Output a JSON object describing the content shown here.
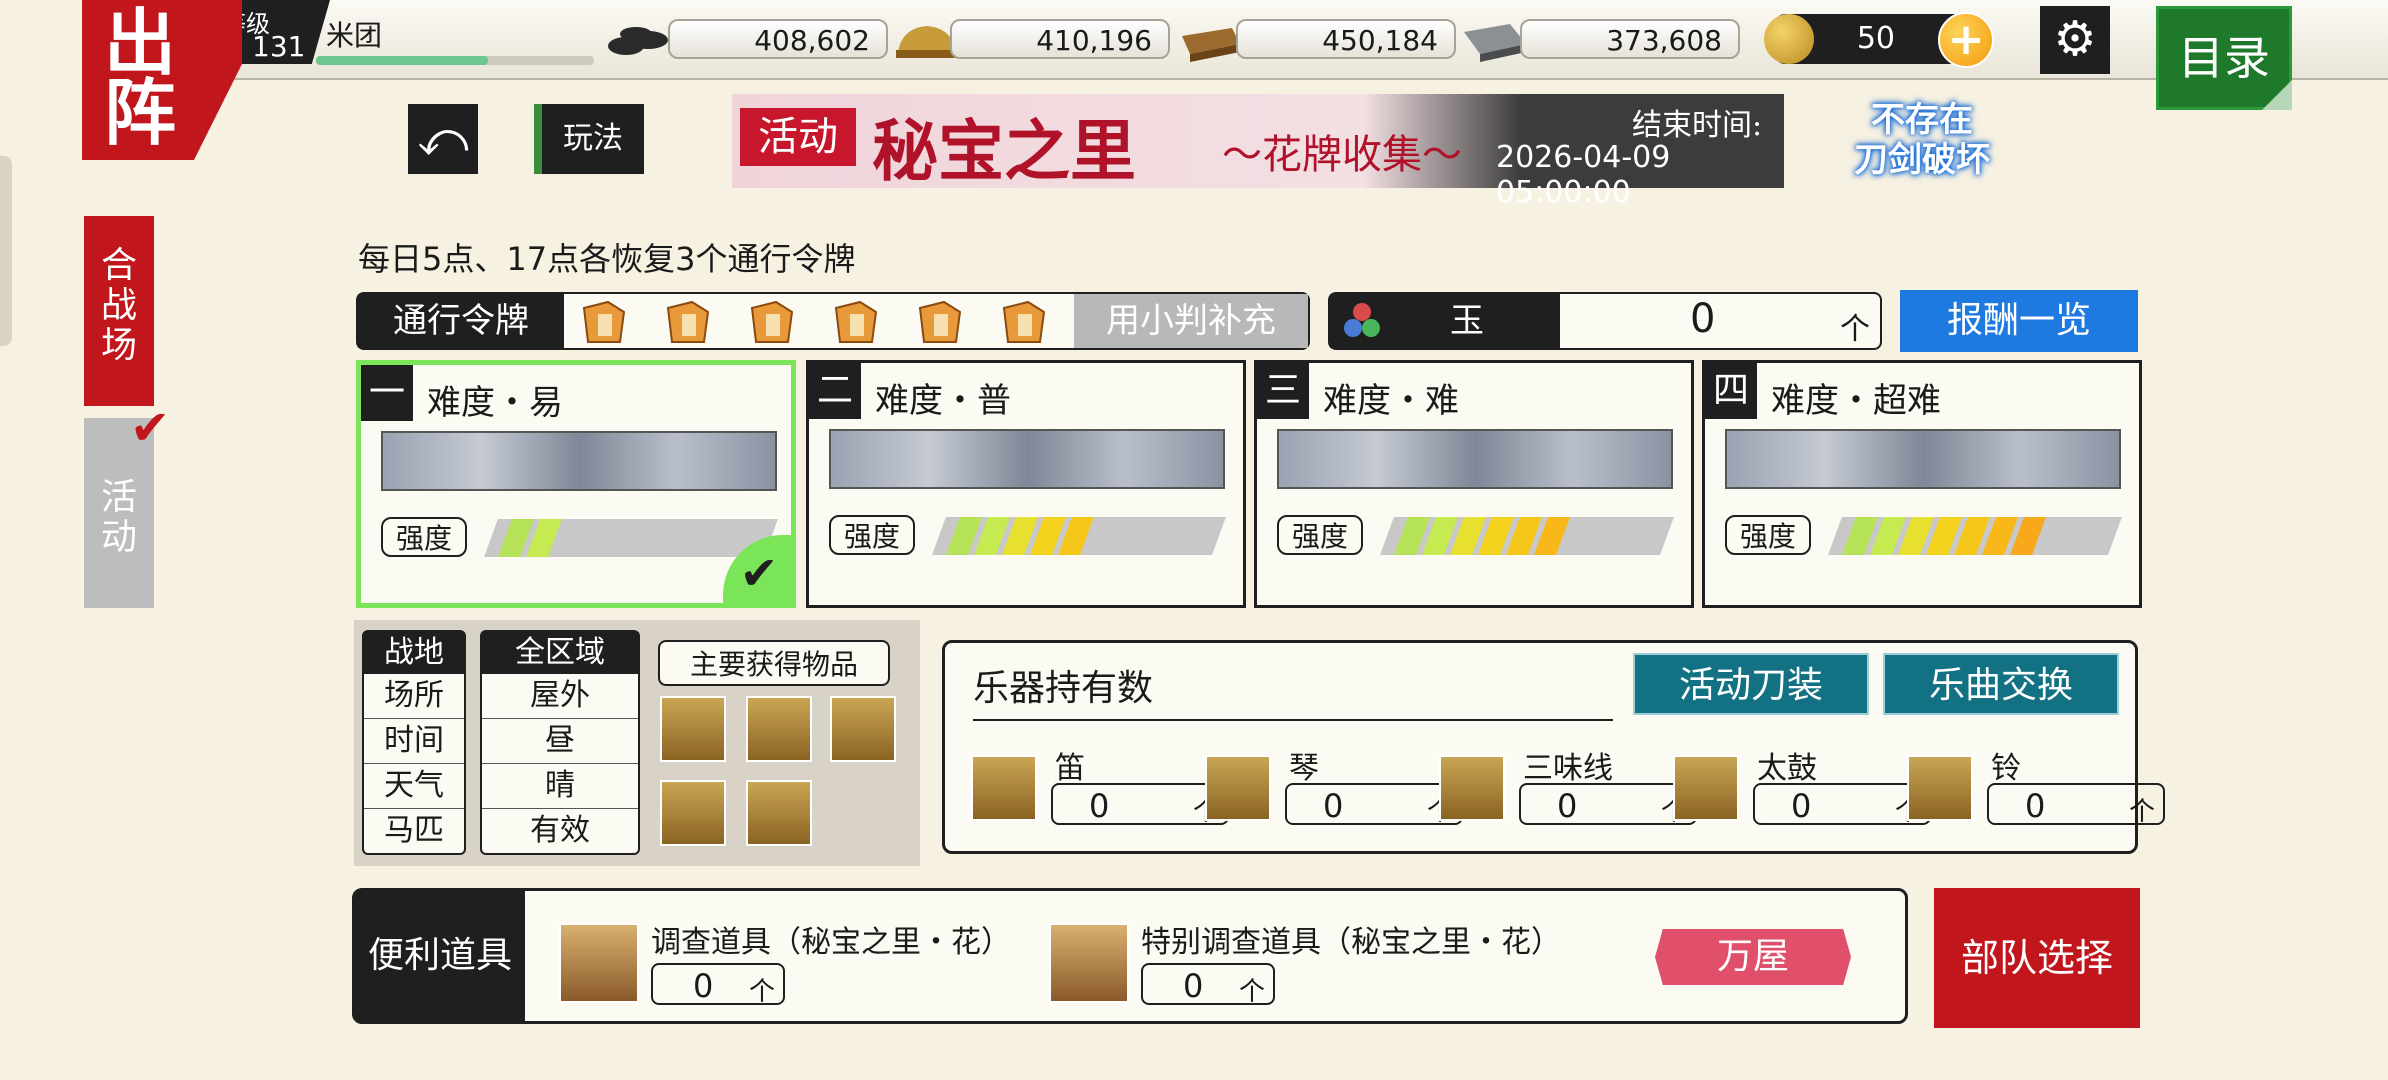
{
  "header": {
    "sortie_label": "出阵",
    "level_label": "等级",
    "level": "131",
    "player_name": "米团",
    "xp_fraction": 0.62,
    "resources": [
      {
        "icon": "charcoal-icon",
        "value": "408,602"
      },
      {
        "icon": "tamahagane-icon",
        "value": "410,196"
      },
      {
        "icon": "cooling-material-icon",
        "value": "450,184"
      },
      {
        "icon": "whetstone-icon",
        "value": "373,608"
      }
    ],
    "coin_value": "50",
    "plus_label": "+",
    "gear_label": "⚙",
    "menu_label": "目录"
  },
  "left_tabs": {
    "war_label": "合战场",
    "event_label": "活动"
  },
  "toolbar": {
    "back_label": "⤺",
    "howto_label": "玩法"
  },
  "banner": {
    "tag": "活动",
    "title": "秘宝之里",
    "subtitle": "～花牌收集～",
    "end_label": "结束时间:",
    "end_time": "2026-04-09 05:00:00"
  },
  "badge": {
    "line1": "不存在",
    "line2": "刀剑破坏"
  },
  "notice": "每日5点、17点各恢复3个通行令牌",
  "pass": {
    "label": "通行令牌",
    "tokens": 6,
    "refill_label": "用小判补充"
  },
  "jade": {
    "label": "玉",
    "value": "0",
    "unit": "个"
  },
  "reward_label": "报酬一览",
  "difficulties": [
    {
      "num": "一",
      "title": "难度・易",
      "strength_label": "强度",
      "strength": 2,
      "selected": true
    },
    {
      "num": "二",
      "title": "难度・普",
      "strength_label": "强度",
      "strength": 5,
      "selected": false
    },
    {
      "num": "三",
      "title": "难度・难",
      "strength_label": "强度",
      "strength": 6,
      "selected": false
    },
    {
      "num": "四",
      "title": "难度・超难",
      "strength_label": "强度",
      "strength": 7,
      "selected": false
    }
  ],
  "field": {
    "col1_header": "战地",
    "col1": [
      "场所",
      "时间",
      "天气",
      "马匹"
    ],
    "col2_header": "全区域",
    "col2": [
      "屋外",
      "昼",
      "晴",
      "有效"
    ],
    "main_items_label": "主要获得物品"
  },
  "instruments": {
    "title": "乐器持有数",
    "btn1": "活动刀装",
    "btn2": "乐曲交换",
    "items": [
      {
        "name": "笛",
        "value": "0",
        "unit": "个"
      },
      {
        "name": "琴",
        "value": "0",
        "unit": "个"
      },
      {
        "name": "三味线",
        "value": "0",
        "unit": "个"
      },
      {
        "name": "太鼓",
        "value": "0",
        "unit": "个"
      },
      {
        "name": "铃",
        "value": "0",
        "unit": "个"
      }
    ]
  },
  "utility": {
    "label": "便利道具",
    "items": [
      {
        "name": "调查道具（秘宝之里・花）",
        "value": "0",
        "unit": "个"
      },
      {
        "name": "特别调查道具（秘宝之里・花）",
        "value": "0",
        "unit": "个"
      }
    ],
    "shop_label": "万屋"
  },
  "squad_label": "部队选择"
}
